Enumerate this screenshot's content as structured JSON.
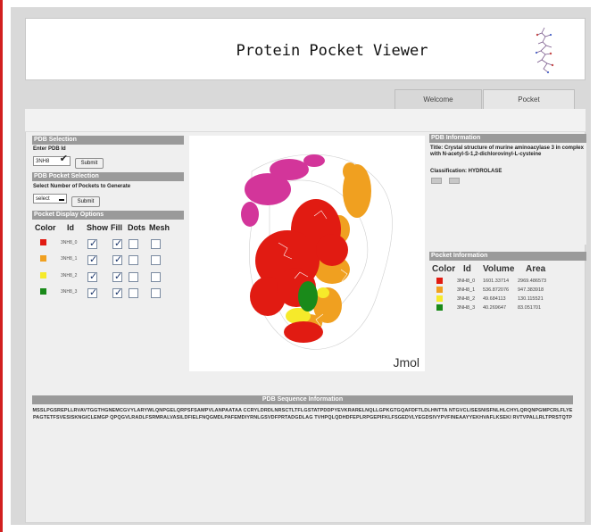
{
  "app": {
    "title": "Protein Pocket Viewer",
    "tabs": [
      {
        "label": "Welcome"
      },
      {
        "label": "Pocket"
      }
    ]
  },
  "left_panel": {
    "pdb_selection": {
      "header": "PDB Selection",
      "prompt": "Enter PDB Id",
      "value": "3NH8",
      "submit_label": "Submit"
    },
    "pocket_selection": {
      "header": "PDB Pocket Selection",
      "prompt": "Select Number of Pockets to Generate",
      "select_value": "select",
      "submit_label": "Submit"
    },
    "display_options": {
      "header": "Pocket Display Options",
      "columns": [
        "Color",
        "Id",
        "Show",
        "Fill",
        "Dots",
        "Mesh"
      ],
      "rows": [
        {
          "id": "3NH8_0",
          "color": "#e11b12",
          "show": true,
          "fill": true,
          "dots": false,
          "mesh": false
        },
        {
          "id": "3NH8_1",
          "color": "#f0a020",
          "show": true,
          "fill": true,
          "dots": false,
          "mesh": false
        },
        {
          "id": "3NH8_2",
          "color": "#f6ea2a",
          "show": true,
          "fill": true,
          "dots": false,
          "mesh": false
        },
        {
          "id": "3NH8_3",
          "color": "#1a8a1a",
          "show": true,
          "fill": true,
          "dots": false,
          "mesh": false
        }
      ]
    }
  },
  "viewer": {
    "watermark": "Jmol"
  },
  "pdb_info": {
    "header": "PDB Information",
    "title_line": "Title: Crystal structure of murine aminoacylase 3 in complex with N-acetyl-S-1,2-dichlorovinyl-L-cysteine",
    "classification": "Classification: HYDROLASE"
  },
  "pocket_info": {
    "header": "Pocket Information",
    "columns": [
      "Color",
      "Id",
      "Volume",
      "Area"
    ],
    "rows": [
      {
        "id": "3NH8_0",
        "color": "#e11b12",
        "volume": "1601.33714",
        "area": "2969.486573"
      },
      {
        "id": "3NH8_1",
        "color": "#f0a020",
        "volume": "536.872076",
        "area": "947.383918"
      },
      {
        "id": "3NH8_2",
        "color": "#f6ea2a",
        "volume": "49.684113",
        "area": "130.115521"
      },
      {
        "id": "3NH8_3",
        "color": "#1a8a1a",
        "volume": "40.269647",
        "area": "83.051701"
      }
    ]
  },
  "sequence": {
    "header": "PDB Sequence Information",
    "text": "MSSLPGSREPLLRVAVTGGTHGNEMCGVYLARYWLQNPGELQRPSFSAMPVLANPAATAA CCRYLDRDLNRSCTLTFLGSTATPDDPYEVKRARELNQLLGPKGTGQAFDFTLDLHNTTA NTGVCLISESNISFNLHLCHYLQRQNPGMPCRLFLYEPAGTETFSVESISKNGICLEMGP QPQGVLRADLFSRMRALVASILDFIELFNQGMDLPAFEMDIYRNLGSVDFPRTADGDLAG TVHPQLQDHDFEPLRPGEPIFKLFSGEDVLYEGDSIVYPVFINEAAYYEKHVAFLKSEKI RVTVPALLRLTPRSTQTP"
  }
}
